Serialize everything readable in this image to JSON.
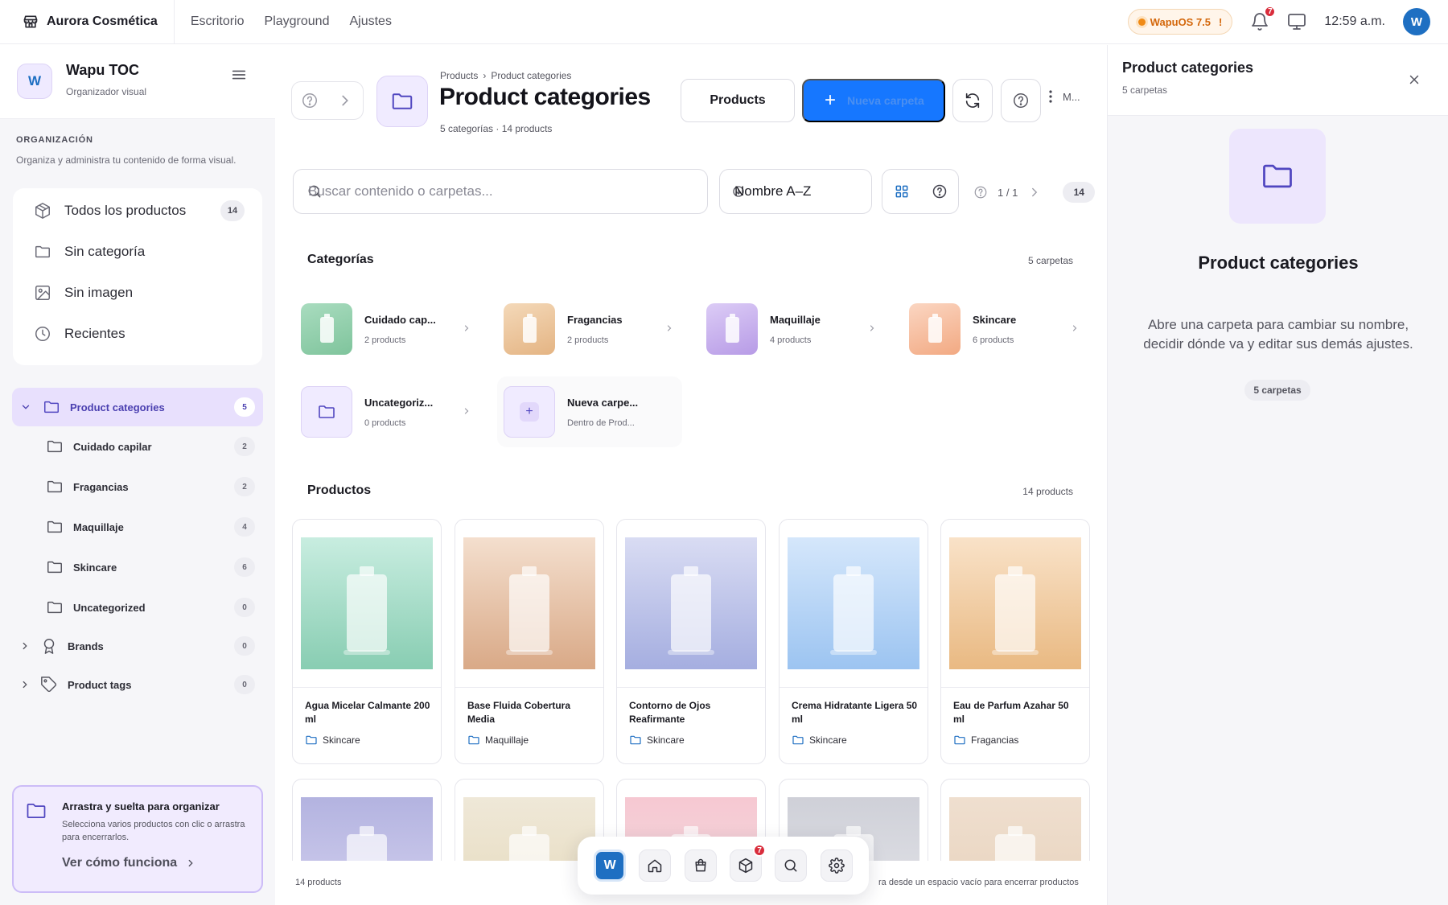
{
  "topbar": {
    "app_title": "Aurora Cosmética",
    "nav": [
      "Escritorio",
      "Playground",
      "Ajustes"
    ],
    "os_badge": "WapuOS 7.5",
    "os_badge_mark": "!",
    "notifications_count": "7",
    "time": "12:59 a.m.",
    "user_initial": "W"
  },
  "sidebar": {
    "workspace_initial": "W",
    "workspace_title": "Wapu TOC",
    "workspace_subtitle": "Organizador visual",
    "section_title": "ORGANIZACIÓN",
    "section_subtitle": "Organiza y administra tu contenido de forma visual.",
    "quick": [
      {
        "label": "Todos los productos",
        "count": "14",
        "icon": "box-icon"
      },
      {
        "label": "Sin categoría",
        "count": "",
        "icon": "folder-icon"
      },
      {
        "label": "Sin imagen",
        "count": "",
        "icon": "image-icon"
      },
      {
        "label": "Recientes",
        "count": "",
        "icon": "clock-icon"
      }
    ],
    "tree_root": {
      "label": "Product categories",
      "count": "5"
    },
    "tree_children": [
      {
        "label": "Cuidado capilar",
        "count": "2"
      },
      {
        "label": "Fragancias",
        "count": "2"
      },
      {
        "label": "Maquillaje",
        "count": "4"
      },
      {
        "label": "Skincare",
        "count": "6"
      },
      {
        "label": "Uncategorized",
        "count": "0"
      }
    ],
    "tree_other": [
      {
        "label": "Brands",
        "count": "0",
        "icon": "award-icon"
      },
      {
        "label": "Product tags",
        "count": "0",
        "icon": "tag-icon"
      }
    ],
    "tip": {
      "title": "Arrastra y suelta para organizar",
      "text": "Selecciona varios productos con clic o arrastra para encerrarlos.",
      "link": "Ver cómo funciona"
    }
  },
  "main": {
    "breadcrumb": [
      "Products",
      "Product categories"
    ],
    "breadcrumb_sep": "›",
    "title": "Product categories",
    "subtitle": "5 categorías · 14 products",
    "products_button": "Products",
    "new_folder_button": "Nueva carpeta",
    "more_label": "M...",
    "search_placeholder": "Buscar contenido o carpetas...",
    "sort_value": "Nombre A–Z",
    "pager": "1 / 1",
    "total_count": "14",
    "categories_title": "Categorías",
    "categories_count": "5 carpetas",
    "categories": [
      {
        "name": "Cuidado cap...",
        "sub": "2 products",
        "color_a": "#a9dcbf",
        "color_b": "#7fc49c"
      },
      {
        "name": "Fragancias",
        "sub": "2 products",
        "color_a": "#f4d9b9",
        "color_b": "#e4b483"
      },
      {
        "name": "Maquillaje",
        "sub": "4 products",
        "color_a": "#dcccf6",
        "color_b": "#b79be6"
      },
      {
        "name": "Skincare",
        "sub": "6 products",
        "color_a": "#fbd6c2",
        "color_b": "#f2a982"
      },
      {
        "name": "Uncategoriz...",
        "sub": "0 products",
        "color_a": "#f0ebff",
        "color_b": "#f0ebff"
      },
      {
        "name": "Nueva carpe...",
        "sub": "Dentro de Prod...",
        "color_a": "#f0ebff",
        "color_b": "#f0ebff"
      }
    ],
    "products_title": "Productos",
    "products_count": "14 products",
    "products": [
      {
        "name": "Agua Micelar Calmante 200 ml",
        "category": "Skincare",
        "color_a": "#c8ede0",
        "color_b": "#88cdb2"
      },
      {
        "name": "Base Fluida Cobertura Media",
        "category": "Maquillaje",
        "color_a": "#f4dfce",
        "color_b": "#d9a987"
      },
      {
        "name": "Contorno de Ojos Reafirmante",
        "category": "Skincare",
        "color_a": "#d9dcf3",
        "color_b": "#a5aee0"
      },
      {
        "name": "Crema Hidratante Ligera 50 ml",
        "category": "Skincare",
        "color_a": "#d5e7fb",
        "color_b": "#9cc4f1"
      },
      {
        "name": "Eau de Parfum Azahar 50 ml",
        "category": "Fragancias",
        "color_a": "#f9e2c8",
        "color_b": "#e9b982"
      }
    ],
    "products_row2": [
      {
        "color_a": "#b3b3e0",
        "color_b": "#c9c7ea"
      },
      {
        "color_a": "#efe8d8",
        "color_b": "#e9dfc6"
      },
      {
        "color_a": "#f6c8d2",
        "color_b": "#f3d6db"
      },
      {
        "color_a": "#cfd0d8",
        "color_b": "#dcdde3"
      },
      {
        "color_a": "#efdfcf",
        "color_b": "#ead6c2"
      }
    ],
    "footer_left": "14 products",
    "footer_right": "ra desde un espacio vacío para encerrar productos"
  },
  "dock": {
    "initial": "W",
    "badge": "7",
    "items": [
      "home-icon",
      "bag-icon",
      "box-icon",
      "search-icon",
      "settings-icon"
    ]
  },
  "panel": {
    "title": "Product categories",
    "subtitle": "5 carpetas",
    "big_title": "Product categories",
    "description": "Abre una carpeta para cambiar su nombre, decidir dónde va y editar sus demás ajustes.",
    "pill": "5 carpetas"
  },
  "colors": {
    "accent": "#1677ff",
    "brand": "#1e6fc2",
    "purple": "#5046c0",
    "badge": "#d92d3c"
  }
}
